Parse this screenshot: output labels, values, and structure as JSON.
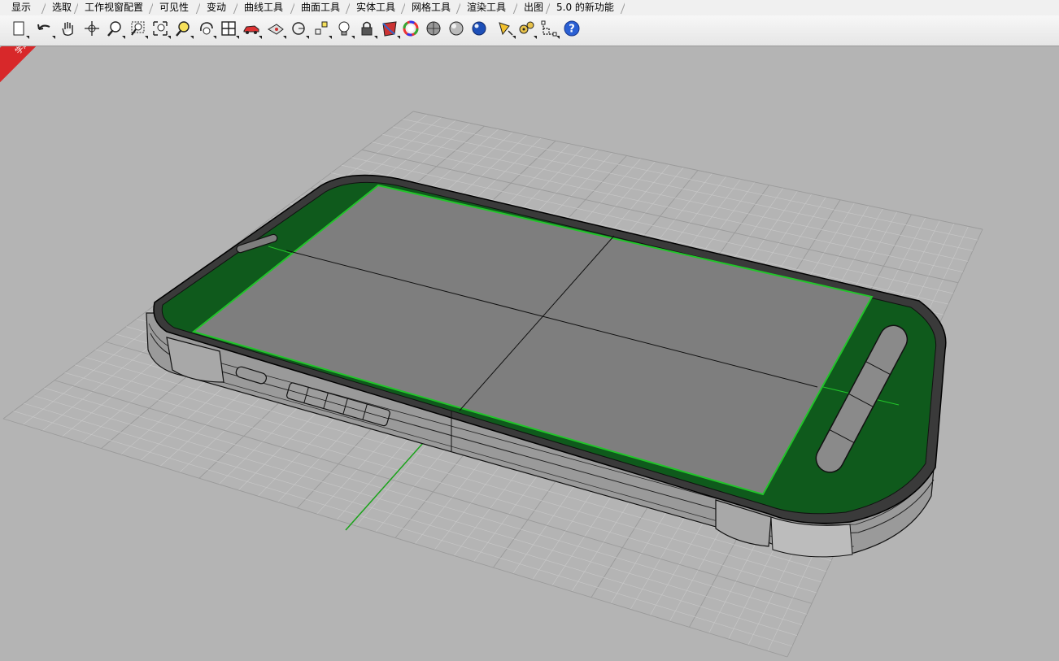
{
  "tabs": [
    {
      "label": "显示"
    },
    {
      "label": "选取"
    },
    {
      "label": "工作视窗配置"
    },
    {
      "label": "可见性"
    },
    {
      "label": "变动"
    },
    {
      "label": "曲线工具"
    },
    {
      "label": "曲面工具"
    },
    {
      "label": "实体工具"
    },
    {
      "label": "网格工具"
    },
    {
      "label": "渲染工具"
    },
    {
      "label": "出图"
    },
    {
      "label": "5.0 的新功能"
    }
  ],
  "toolbar": {
    "icons": [
      "new-document-icon",
      "undo-icon",
      "pan-hand-icon",
      "rotate-view-icon",
      "zoom-icon",
      "zoom-window-icon",
      "zoom-extents-icon",
      "zoom-selected-icon",
      "undo-view-icon",
      "four-viewports-icon",
      "car-render-icon",
      "hide-icon",
      "circle-icon",
      "point-icon",
      "light-bulb-icon",
      "lock-icon",
      "material-icon",
      "color-wheel-icon",
      "shaded-sphere-icon",
      "rendered-sphere-icon",
      "blue-sphere-icon",
      "pencil-icon",
      "options-gear-icon",
      "dimension-icon",
      "help-icon"
    ]
  },
  "watermark": {
    "line1": "xuexiniu",
    "line2": "学犀牛中文网"
  },
  "colors": {
    "screen_green": "#0f5a1c",
    "screen_border": "#22c42a",
    "screen_gray": "#7e7e7e",
    "grid": "#cfcfcf",
    "background": "#b4b4b4"
  }
}
